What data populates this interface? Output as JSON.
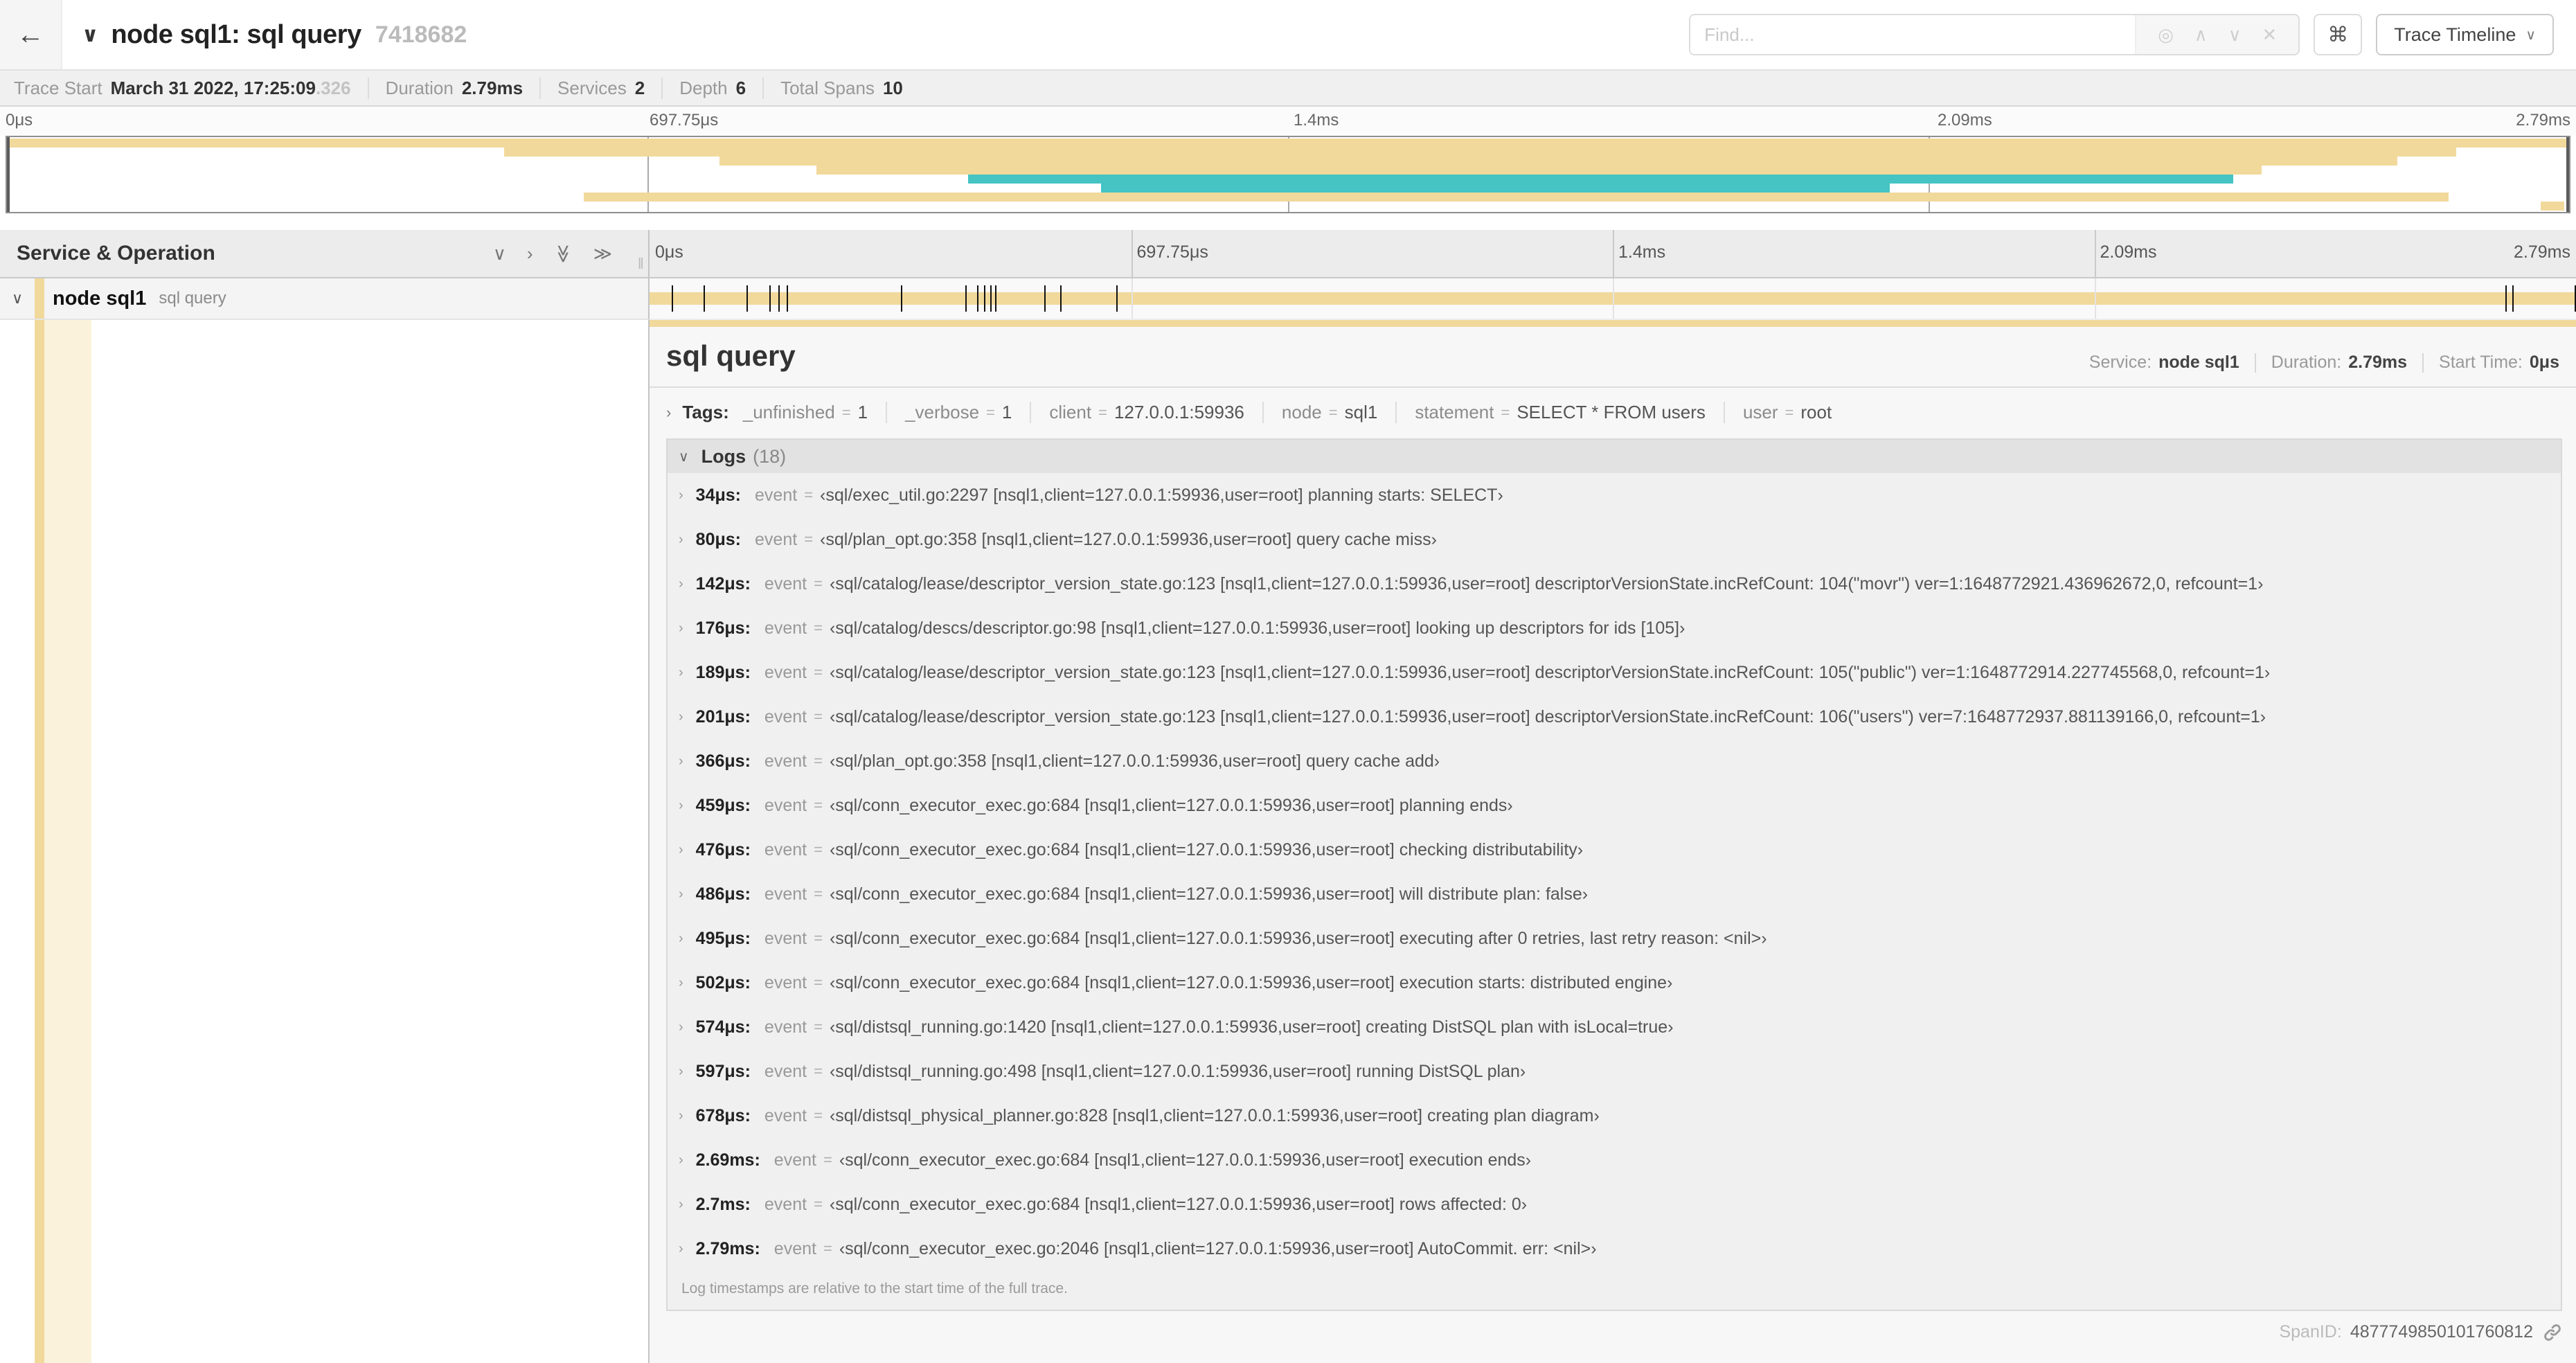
{
  "colors": {
    "tan": "#f1d99b",
    "teal": "#46c4c4",
    "cream": "#faf2da"
  },
  "header": {
    "back_icon": "←",
    "collapse_icon": "∨",
    "title": "node sql1: sql query",
    "trace_id_short": "7418682",
    "find_placeholder": "Find...",
    "find_icons": {
      "aim": "◎",
      "prev": "∧",
      "next": "∨",
      "clear": "✕"
    },
    "shortcut_icon": "⌘",
    "view_label": "Trace Timeline",
    "view_caret": "∨"
  },
  "trace_info": [
    {
      "label": "Trace Start",
      "value": "March 31 2022, 17:25:09",
      "muted": ".326"
    },
    {
      "label": "Duration",
      "value": "2.79ms",
      "muted": ""
    },
    {
      "label": "Services",
      "value": "2",
      "muted": ""
    },
    {
      "label": "Depth",
      "value": "6",
      "muted": ""
    },
    {
      "label": "Total Spans",
      "value": "10",
      "muted": ""
    }
  ],
  "timeline": {
    "duration_us": 2790,
    "ticks": [
      {
        "label": "0μs",
        "pct": 0
      },
      {
        "label": "697.75μs",
        "pct": 25
      },
      {
        "label": "1.4ms",
        "pct": 50
      },
      {
        "label": "2.09ms",
        "pct": 75
      },
      {
        "label": "2.79ms",
        "pct": 100
      }
    ],
    "minimap_spans": [
      {
        "row": 0,
        "start": 0,
        "end": 100,
        "color": "tan"
      },
      {
        "row": 1,
        "start": 19.4,
        "end": 95.6,
        "color": "tan"
      },
      {
        "row": 2,
        "start": 27.8,
        "end": 93.3,
        "color": "tan"
      },
      {
        "row": 3,
        "start": 31.6,
        "end": 88,
        "color": "tan"
      },
      {
        "row": 4,
        "start": 37.5,
        "end": 86.9,
        "color": "teal"
      },
      {
        "row": 5,
        "start": 42.7,
        "end": 73.5,
        "color": "teal"
      },
      {
        "row": 6,
        "start": 22.5,
        "end": 95.3,
        "color": "tan"
      },
      {
        "row": 7,
        "start": 98.9,
        "end": 99.8,
        "color": "tan"
      }
    ]
  },
  "span_tree": {
    "header_label": "Service & Operation",
    "icons": {
      "collapse_one": "∨",
      "expand_one": "›",
      "collapse_all": "≫",
      "expand_all": "≫"
    },
    "grip": "‖",
    "row": {
      "expander": "∨",
      "service": "node sql1",
      "operation": "sql query"
    }
  },
  "detail": {
    "title": "sql query",
    "meta": {
      "service_label": "Service:",
      "service_value": "node sql1",
      "duration_label": "Duration:",
      "duration_value": "2.79ms",
      "start_label": "Start Time:",
      "start_value": "0μs"
    },
    "tags_chevron": "›",
    "tags_label": "Tags:",
    "tags": [
      {
        "key": "_unfinished",
        "value": "1"
      },
      {
        "key": "_verbose",
        "value": "1"
      },
      {
        "key": "client",
        "value": "127.0.0.1:59936"
      },
      {
        "key": "node",
        "value": "sql1"
      },
      {
        "key": "statement",
        "value": "SELECT * FROM users"
      },
      {
        "key": "user",
        "value": "root"
      }
    ],
    "logs_chevron": "∨",
    "logs_label": "Logs",
    "logs_count": "(18)",
    "log_field": "event",
    "logs": [
      {
        "us": 34,
        "time": "34μs:",
        "value": "‹sql/exec_util.go:2297 [nsql1,client=127.0.0.1:59936,user=root] planning starts: SELECT›"
      },
      {
        "us": 80,
        "time": "80μs:",
        "value": "‹sql/plan_opt.go:358 [nsql1,client=127.0.0.1:59936,user=root] query cache miss›"
      },
      {
        "us": 142,
        "time": "142μs:",
        "value": "‹sql/catalog/lease/descriptor_version_state.go:123 [nsql1,client=127.0.0.1:59936,user=root] descriptorVersionState.incRefCount: 104(\"movr\") ver=1:1648772921.436962672,0, refcount=1›"
      },
      {
        "us": 176,
        "time": "176μs:",
        "value": "‹sql/catalog/descs/descriptor.go:98 [nsql1,client=127.0.0.1:59936,user=root] looking up descriptors for ids [105]›"
      },
      {
        "us": 189,
        "time": "189μs:",
        "value": "‹sql/catalog/lease/descriptor_version_state.go:123 [nsql1,client=127.0.0.1:59936,user=root] descriptorVersionState.incRefCount: 105(\"public\") ver=1:1648772914.227745568,0, refcount=1›"
      },
      {
        "us": 201,
        "time": "201μs:",
        "value": "‹sql/catalog/lease/descriptor_version_state.go:123 [nsql1,client=127.0.0.1:59936,user=root] descriptorVersionState.incRefCount: 106(\"users\") ver=7:1648772937.881139166,0, refcount=1›"
      },
      {
        "us": 366,
        "time": "366μs:",
        "value": "‹sql/plan_opt.go:358 [nsql1,client=127.0.0.1:59936,user=root] query cache add›"
      },
      {
        "us": 459,
        "time": "459μs:",
        "value": "‹sql/conn_executor_exec.go:684 [nsql1,client=127.0.0.1:59936,user=root] planning ends›"
      },
      {
        "us": 476,
        "time": "476μs:",
        "value": "‹sql/conn_executor_exec.go:684 [nsql1,client=127.0.0.1:59936,user=root] checking distributability›"
      },
      {
        "us": 486,
        "time": "486μs:",
        "value": "‹sql/conn_executor_exec.go:684 [nsql1,client=127.0.0.1:59936,user=root] will distribute plan: false›"
      },
      {
        "us": 495,
        "time": "495μs:",
        "value": "‹sql/conn_executor_exec.go:684 [nsql1,client=127.0.0.1:59936,user=root] executing after 0 retries, last retry reason: <nil>›"
      },
      {
        "us": 502,
        "time": "502μs:",
        "value": "‹sql/conn_executor_exec.go:684 [nsql1,client=127.0.0.1:59936,user=root] execution starts: distributed engine›"
      },
      {
        "us": 574,
        "time": "574μs:",
        "value": "‹sql/distsql_running.go:1420 [nsql1,client=127.0.0.1:59936,user=root] creating DistSQL plan with isLocal=true›"
      },
      {
        "us": 597,
        "time": "597μs:",
        "value": "‹sql/distsql_running.go:498 [nsql1,client=127.0.0.1:59936,user=root] running DistSQL plan›"
      },
      {
        "us": 678,
        "time": "678μs:",
        "value": "‹sql/distsql_physical_planner.go:828 [nsql1,client=127.0.0.1:59936,user=root] creating plan diagram›"
      },
      {
        "us": 2690,
        "time": "2.69ms:",
        "value": "‹sql/conn_executor_exec.go:684 [nsql1,client=127.0.0.1:59936,user=root] execution ends›"
      },
      {
        "us": 2700,
        "time": "2.7ms:",
        "value": "‹sql/conn_executor_exec.go:684 [nsql1,client=127.0.0.1:59936,user=root] rows affected: 0›"
      },
      {
        "us": 2790,
        "time": "2.79ms:",
        "value": "‹sql/conn_executor_exec.go:2046 [nsql1,client=127.0.0.1:59936,user=root] AutoCommit. err: <nil>›"
      }
    ],
    "footer_note": "Log timestamps are relative to the start time of the full trace.",
    "span_id_label": "SpanID:",
    "span_id": "4877749850101760812"
  }
}
